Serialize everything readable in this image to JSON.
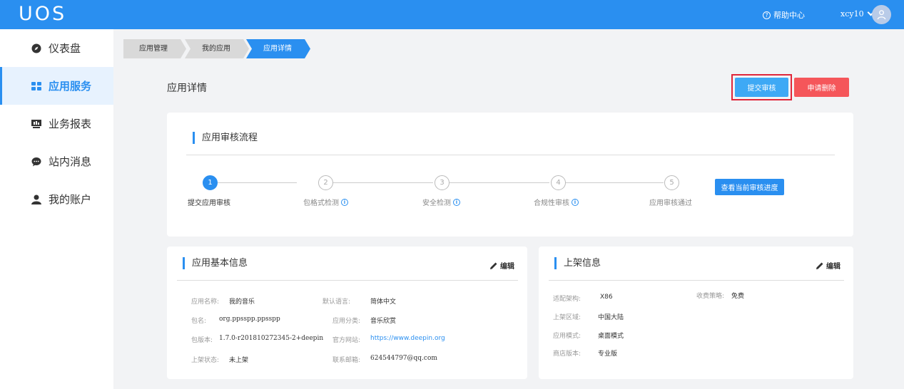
{
  "header": {
    "logo": "UOS",
    "help_label": "帮助中心",
    "username": "xcy10"
  },
  "sidebar": {
    "items": [
      {
        "label": "仪表盘",
        "icon": "dashboard-icon"
      },
      {
        "label": "应用服务",
        "icon": "grid-icon",
        "active": true
      },
      {
        "label": "业务报表",
        "icon": "report-icon"
      },
      {
        "label": "站内消息",
        "icon": "message-icon"
      },
      {
        "label": "我的账户",
        "icon": "user-icon"
      }
    ]
  },
  "breadcrumb": [
    "应用管理",
    "我的应用",
    "应用详情"
  ],
  "page": {
    "title": "应用详情",
    "submit_label": "提交审核",
    "delete_label": "申请删除"
  },
  "review": {
    "title": "应用审核流程",
    "steps": [
      {
        "num": "1",
        "label": "提交应用审核",
        "info": false
      },
      {
        "num": "2",
        "label": "包格式检测",
        "info": true
      },
      {
        "num": "3",
        "label": "安全检测",
        "info": true
      },
      {
        "num": "4",
        "label": "合规性审核",
        "info": true
      },
      {
        "num": "5",
        "label": "应用审核通过",
        "info": false
      }
    ],
    "progress_button": "查看当前审核进度"
  },
  "basic": {
    "title": "应用基本信息",
    "edit_label": "编辑",
    "left": [
      {
        "label": "应用名称:",
        "value": "我的音乐"
      },
      {
        "label": "包名:",
        "value": "org.ppsspp.ppsspp"
      },
      {
        "label": "包版本:",
        "value": "1.7.0-r201810272345-2+deepin"
      },
      {
        "label": "上架状态:",
        "value": "未上架"
      }
    ],
    "right": [
      {
        "label": "默认语言:",
        "value": "简体中文"
      },
      {
        "label": "应用分类:",
        "value": "音乐欣赏"
      },
      {
        "label": "官方网站:",
        "value": "https://www.deepin.org"
      },
      {
        "label": "联系邮箱:",
        "value": "624544797@qq.com"
      }
    ]
  },
  "listing": {
    "title": "上架信息",
    "edit_label": "编辑",
    "left": [
      {
        "label": "适配架构:",
        "value": "X86"
      },
      {
        "label": "上架区域:",
        "value": "中国大陆"
      },
      {
        "label": "应用模式:",
        "value": "桌面模式"
      },
      {
        "label": "商店版本:",
        "value": "专业版"
      }
    ],
    "right": [
      {
        "label": "收费策略:",
        "value": "免费"
      }
    ]
  },
  "colors": {
    "primary": "#2a8ff0",
    "danger": "#f5565a",
    "highlight": "#e0263a"
  }
}
